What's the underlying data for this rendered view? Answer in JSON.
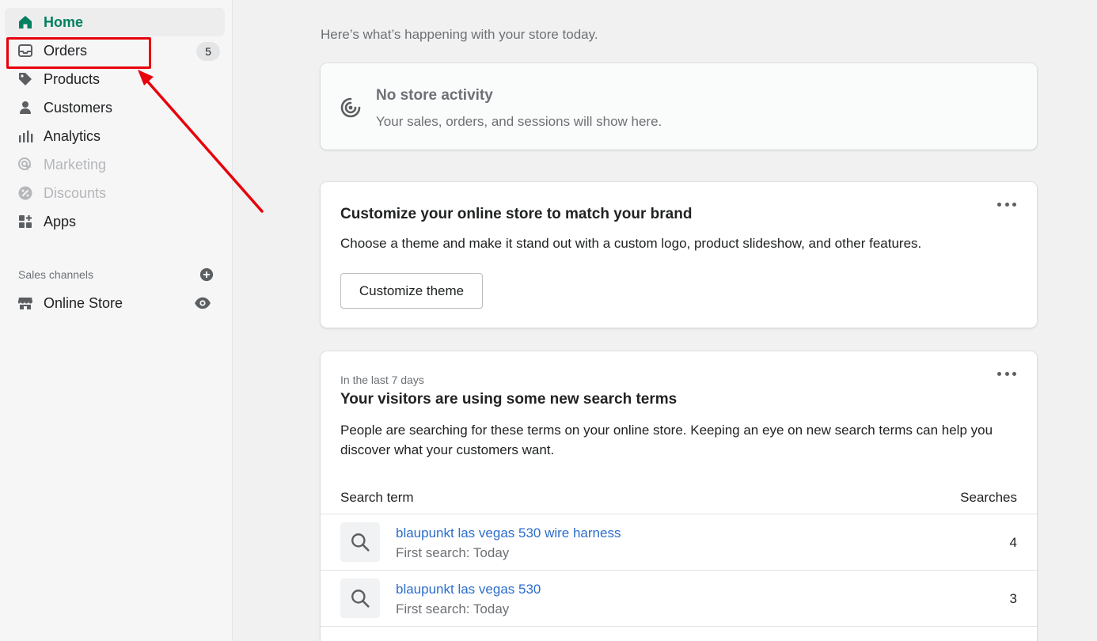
{
  "sidebar": {
    "nav": [
      {
        "label": "Home",
        "icon": "home-icon",
        "state": "active"
      },
      {
        "label": "Orders",
        "icon": "inbox-icon",
        "badge": "5"
      },
      {
        "label": "Products",
        "icon": "tag-icon"
      },
      {
        "label": "Customers",
        "icon": "person-icon"
      },
      {
        "label": "Analytics",
        "icon": "bar-chart-icon"
      },
      {
        "label": "Marketing",
        "icon": "target-icon",
        "state": "disabled"
      },
      {
        "label": "Discounts",
        "icon": "discount-icon",
        "state": "disabled"
      },
      {
        "label": "Apps",
        "icon": "apps-icon"
      }
    ],
    "sales_channels": {
      "title": "Sales channels",
      "add_icon": "plus-circle-icon",
      "items": [
        {
          "label": "Online Store",
          "icon": "store-icon",
          "action_icon": "eye-icon"
        }
      ]
    }
  },
  "main": {
    "greeting": "Here’s what’s happening with your store today.",
    "activity": {
      "icon": "radar-icon",
      "title": "No store activity",
      "description": "Your sales, orders, and sessions will show here."
    },
    "customize": {
      "title": "Customize your online store to match your brand",
      "description": "Choose a theme and make it stand out with a custom logo, product slideshow, and other features.",
      "button_label": "Customize theme"
    },
    "search_terms": {
      "tag": "In the last 7 days",
      "title": "Your visitors are using some new search terms",
      "description": "People are searching for these terms on your online store. Keeping an eye on new search terms can help you discover what your customers want.",
      "columns": [
        "Search term",
        "Searches"
      ],
      "rows": [
        {
          "term": "blaupunkt las vegas 530 wire harness",
          "first_search": "First search: Today",
          "count": "4"
        },
        {
          "term": "blaupunkt las vegas 530",
          "first_search": "First search: Today",
          "count": "3"
        }
      ]
    }
  },
  "colors": {
    "accent_green": "#008060",
    "link_blue": "#2c6ecb",
    "annotation_red": "#e8000a"
  }
}
